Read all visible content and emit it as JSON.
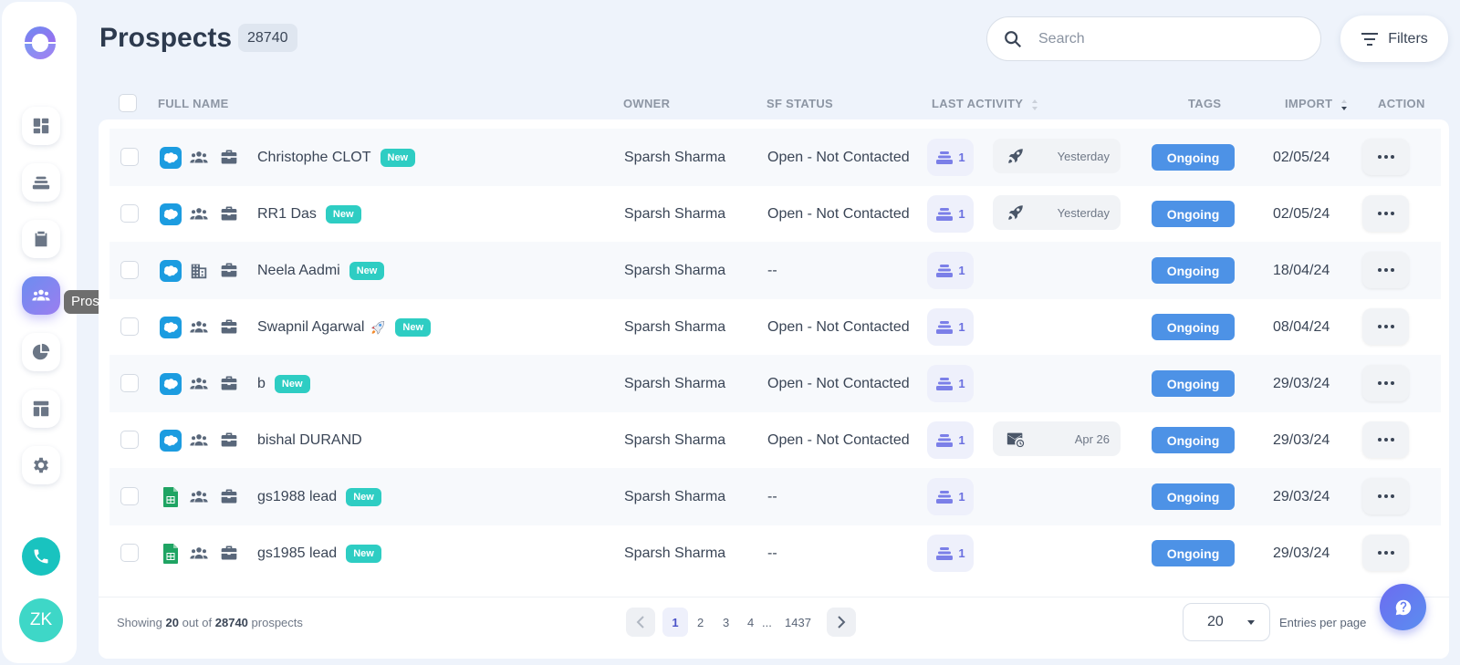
{
  "sidebar": {
    "tooltip": "Prospects",
    "avatar_initials": "ZK"
  },
  "header": {
    "title": "Prospects",
    "count": "28740",
    "search_placeholder": "Search",
    "filters_label": "Filters"
  },
  "table": {
    "columns": {
      "full_name": "FULL NAME",
      "owner": "OWNER",
      "sf_status": "SF STATUS",
      "last_activity": "LAST ACTIVITY",
      "tags": "TAGS",
      "import": "IMPORT",
      "action": "ACTION"
    },
    "rows": [
      {
        "name": "Christophe CLOT",
        "new": "New",
        "owner": "Sparsh Sharma",
        "sf_status": "Open - Not Contacted",
        "seq": "1",
        "activity": "Yesterday",
        "activity_icon": "rocket-icon",
        "tag": "Ongoing",
        "import": "02/05/24",
        "source": "salesforce",
        "type": "people"
      },
      {
        "name": "RR1 Das",
        "new": "New",
        "owner": "Sparsh Sharma",
        "sf_status": "Open - Not Contacted",
        "seq": "1",
        "activity": "Yesterday",
        "activity_icon": "rocket-icon",
        "tag": "Ongoing",
        "import": "02/05/24",
        "source": "salesforce",
        "type": "people"
      },
      {
        "name": "Neela Aadmi",
        "new": "New",
        "owner": "Sparsh Sharma",
        "sf_status": "--",
        "seq": "1",
        "activity": "",
        "activity_icon": "",
        "tag": "Ongoing",
        "import": "18/04/24",
        "source": "salesforce",
        "type": "building"
      },
      {
        "name": "Swapnil Agarwal",
        "new": "New",
        "owner": "Sparsh Sharma",
        "sf_status": "Open - Not Contacted",
        "seq": "1",
        "activity": "",
        "activity_icon": "",
        "tag": "Ongoing",
        "import": "08/04/24",
        "source": "salesforce",
        "type": "people",
        "emoji": true
      },
      {
        "name": "b",
        "new": "New",
        "owner": "Sparsh Sharma",
        "sf_status": "Open - Not Contacted",
        "seq": "1",
        "activity": "",
        "activity_icon": "",
        "tag": "Ongoing",
        "import": "29/03/24",
        "source": "salesforce",
        "type": "people"
      },
      {
        "name": "bishal DURAND",
        "new": "",
        "owner": "Sparsh Sharma",
        "sf_status": "Open - Not Contacted",
        "seq": "1",
        "activity": "Apr 26",
        "activity_icon": "mail-icon",
        "tag": "Ongoing",
        "import": "29/03/24",
        "source": "salesforce",
        "type": "people"
      },
      {
        "name": "gs1988 lead",
        "new": "New",
        "owner": "Sparsh Sharma",
        "sf_status": "--",
        "seq": "1",
        "activity": "",
        "activity_icon": "",
        "tag": "Ongoing",
        "import": "29/03/24",
        "source": "sheets",
        "type": "people"
      },
      {
        "name": "gs1985 lead",
        "new": "New",
        "owner": "Sparsh Sharma",
        "sf_status": "--",
        "seq": "1",
        "activity": "",
        "activity_icon": "",
        "tag": "Ongoing",
        "import": "29/03/24",
        "source": "sheets",
        "type": "people"
      }
    ]
  },
  "footer": {
    "showing_prefix": "Showing",
    "showing_count": "20",
    "showing_mid": "out of",
    "showing_total": "28740",
    "showing_suffix": "prospects",
    "pages": [
      "1",
      "2",
      "3",
      "4"
    ],
    "ellipsis": "...",
    "last_page": "1437",
    "per_page": "20",
    "entries_label": "Entries per page"
  },
  "colors": {
    "accent": "#6c8df0",
    "tag_blue": "#4d92e6",
    "new_teal": "#2ecdc3",
    "salesforce": "#1c9ce0"
  }
}
